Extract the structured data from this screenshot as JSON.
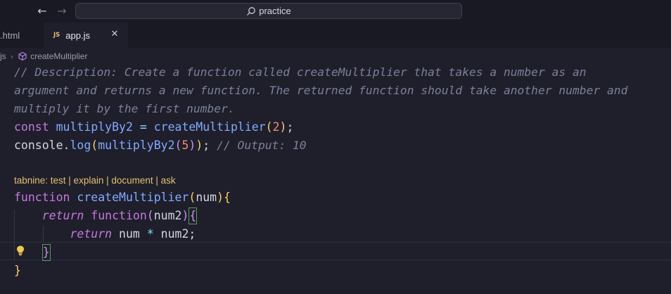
{
  "titlebar": {
    "back_icon": "arrow-left-icon",
    "forward_icon": "arrow-right-icon",
    "search_text": "practice"
  },
  "tabs": [
    {
      "label": ".html",
      "active": false
    },
    {
      "label": "app.js",
      "active": true,
      "badge": "JS"
    }
  ],
  "breadcrumb": {
    "file": "js",
    "symbol": "createMultiplier"
  },
  "editor": {
    "comment_1": "// Description: Create a function called createMultiplier that takes a number as an",
    "comment_2": "argument and returns a new function. The returned function should take another number and",
    "comment_3": "multiply it by the first number.",
    "codelens": "tabnine: test | explain | document | ask"
  },
  "colors": {
    "background": "#1e1f2b",
    "keyword": "#c678dd",
    "function": "#82aaff",
    "number": "#f78c6c",
    "comment": "#7c8099",
    "codelens": "#e5c16e"
  }
}
